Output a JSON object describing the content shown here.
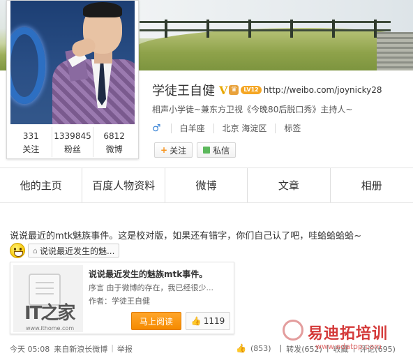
{
  "profile": {
    "name": "学徒王自健",
    "verified_mark": "V",
    "level_badge": "LV12",
    "home_url": "http://weibo.com/joynicky28",
    "bio": "相声小学徒~兼东方卫视《今晚80后脱口秀》主持人~",
    "gender_symbol": "♂",
    "constellation": "白羊座",
    "location": "北京 海淀区",
    "tags_label": "标签",
    "follow_label": "关注",
    "message_label": "私信",
    "stats": [
      {
        "value": "331",
        "label": "关注"
      },
      {
        "value": "1339845",
        "label": "粉丝"
      },
      {
        "value": "6812",
        "label": "微博"
      }
    ]
  },
  "tabs": [
    "他的主页",
    "百度人物资料",
    "微博",
    "文章",
    "相册"
  ],
  "post": {
    "text": "说说最近的mtk魅族事件。这是校对版，如果还有错字，你们自己认了吧，哇蛤蛤蛤蛤~",
    "tag_chip": "说说最近发生的魅...",
    "card": {
      "title": "说说最近发生的魅族mtk事件。",
      "preface": "序言 由于微博的存在，我已经很少...",
      "author": "作者：学徒王自健",
      "read_label": "马上阅读",
      "like_count": "1119",
      "thumb_logo": "IT之家",
      "thumb_domain": "www.ithome.com"
    },
    "footer": {
      "time": "今天 05:08",
      "source": "来自新浪长微博",
      "report": "举报",
      "likes": "(853)",
      "repost": "转发(652)",
      "favorite": "收藏",
      "comment": "评论(695)"
    }
  },
  "watermark": {
    "site_name": "易迪拓培训",
    "site_url": "www.edatop.com"
  }
}
